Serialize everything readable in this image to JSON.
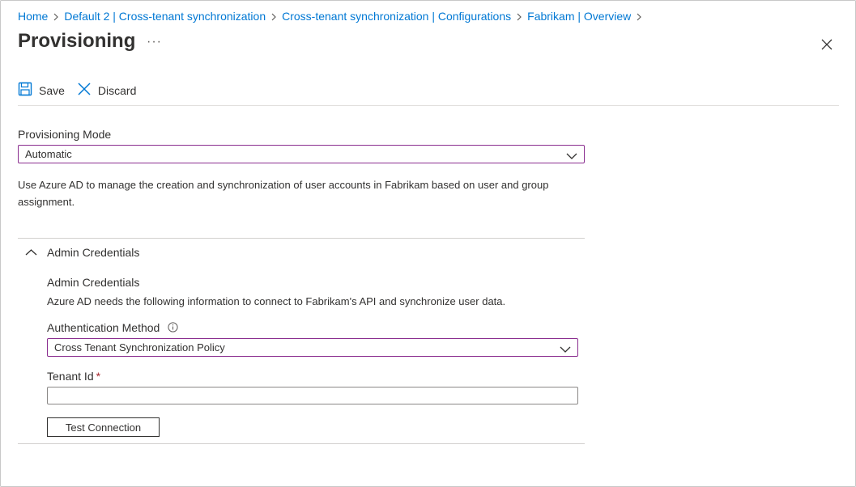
{
  "breadcrumb": [
    "Home",
    "Default 2 | Cross-tenant synchronization",
    "Cross-tenant synchronization | Configurations",
    "Fabrikam | Overview"
  ],
  "header": {
    "title": "Provisioning",
    "more": "···"
  },
  "toolbar": {
    "save_label": "Save",
    "discard_label": "Discard"
  },
  "provisioning": {
    "mode_label": "Provisioning Mode",
    "mode_value": "Automatic",
    "description": "Use Azure AD to manage the creation and synchronization of user accounts in Fabrikam based on user and group assignment."
  },
  "admin": {
    "section_label": "Admin Credentials",
    "heading": "Admin Credentials",
    "description": "Azure AD needs the following information to connect to Fabrikam's API and synchronize user data.",
    "auth_label": "Authentication Method",
    "auth_value": "Cross Tenant Synchronization Policy",
    "tenant_label": "Tenant Id",
    "tenant_required": "*",
    "tenant_value": "",
    "test_button": "Test Connection"
  },
  "colors": {
    "link": "#0078d4",
    "focus_border": "#8a2d8f",
    "required": "#a4262c"
  },
  "icons": [
    "chevron-right-icon",
    "save-icon",
    "discard-icon",
    "close-icon",
    "chevron-down-icon",
    "chevron-up-icon",
    "info-icon"
  ]
}
